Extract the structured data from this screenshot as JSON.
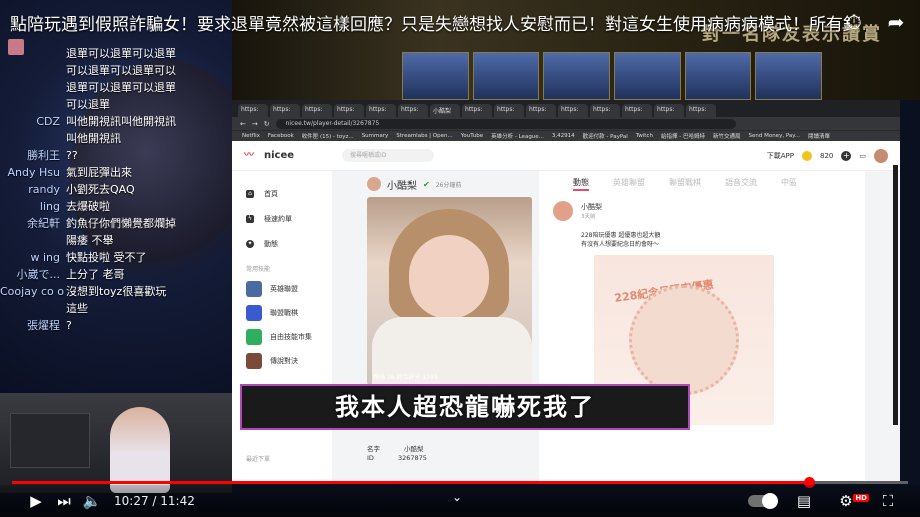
{
  "video": {
    "title": "點陪玩遇到假照詐騙女！要求退單竟然被這樣回應？只是失戀想找人安慰而已！對這女生使用病病病模式！所有錯都..."
  },
  "banner": {
    "text": "對一名隊友表示讚賞"
  },
  "chat": [
    {
      "user": "",
      "text": "退單可以退單可以退單可以退單可以退單可以退單可以退單可以退單可以退單"
    },
    {
      "user": "CDZ",
      "text": "叫他開視訊叫他開視訊叫他開視訊"
    },
    {
      "user": "勝利王",
      "text": "??"
    },
    {
      "user": "Andy Hsu",
      "text": "氣到屁彈出來"
    },
    {
      "user": "randy",
      "text": "小劉死去QAQ"
    },
    {
      "user": "ling",
      "text": "去爆破啦"
    },
    {
      "user": "余紀軒",
      "text": "釣魚仔你們懶覺都爛掉 陽痿 不舉"
    },
    {
      "user": "w ing",
      "text": "快點投啦 受不了"
    },
    {
      "user": "小崴で...",
      "text": "上分了 老哥"
    },
    {
      "user": "Coojay co o",
      "text": "沒想到toyz很喜歡玩這些"
    },
    {
      "user": "張燿程",
      "text": "?"
    }
  ],
  "browser": {
    "tabs": [
      "https:",
      "https:",
      "https:",
      "https:",
      "https:",
      "https:",
      "小酷梨",
      "https:",
      "https:",
      "https:",
      "https:",
      "https:",
      "https:",
      "https:",
      "https:"
    ],
    "url": "nicee.tw/player-detail/3267875",
    "bookmarks": [
      "Netflix",
      "Facebook",
      "收件匣 (15) - toyz...",
      "Summary",
      "Streamlabs | Open...",
      "YouTube",
      "英雄分析 - League...",
      "3,42914",
      "歡迎付款 - PayPal",
      "Twitch",
      "給指揮 - 巴哈姆特",
      "新竹交通局",
      "Send Money, Pay...",
      "閱讀清單"
    ]
  },
  "site": {
    "logo": "nicee",
    "search_placeholder": "搜尋暱稱或ID",
    "download": "下載APP",
    "coins": "820",
    "nav": [
      {
        "label": "首頁",
        "icon": "home-icon"
      },
      {
        "label": "極速約單",
        "icon": "lightning-icon"
      },
      {
        "label": "動態",
        "icon": "compass-icon"
      }
    ],
    "group_title": "常用技能",
    "games": [
      {
        "label": "英雄聯盟"
      },
      {
        "label": "聯盟戰棋"
      },
      {
        "label": "自由技能市集"
      },
      {
        "label": "傳說對決"
      }
    ],
    "footer": "最近下單"
  },
  "profile": {
    "name": "小酷梨",
    "ago": "26分鐘前",
    "stats": "粉絲 16   綜合評分 1293",
    "info": [
      {
        "k": "名字",
        "v": "小酷梨"
      },
      {
        "k": "ID",
        "v": "3267875"
      }
    ]
  },
  "feed": {
    "tabs": [
      "動態",
      "英雄聯盟",
      "聯盟戰棋",
      "語音交流",
      "中區"
    ],
    "post_name": "小酷梨",
    "post_time": "3天前",
    "post_text_1": "228陪玩優惠 超優惠也超大額",
    "post_text_2": "有沒有人想要紀念日約會呀～",
    "post_img_head": "228紀念日限定優惠"
  },
  "subtitle": "我本人超恐龍嚇死我了",
  "player": {
    "time": "10:27 / 11:42",
    "progress": 0.889
  }
}
